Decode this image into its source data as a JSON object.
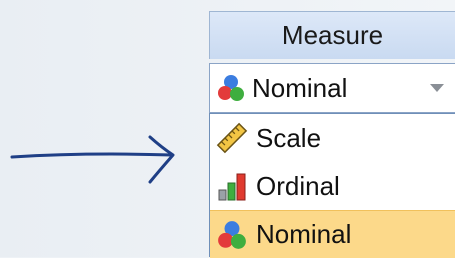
{
  "column": {
    "header": "Measure"
  },
  "combo": {
    "value": "Nominal",
    "icon": "nominal-icon"
  },
  "dropdown": {
    "options": [
      {
        "label": "Scale",
        "icon": "scale-ruler-icon"
      },
      {
        "label": "Ordinal",
        "icon": "ordinal-bars-icon"
      },
      {
        "label": "Nominal",
        "icon": "nominal-icon",
        "selected": true
      }
    ]
  },
  "colors": {
    "header_bg": "#c9daf1",
    "selected_bg": "#fcd98a",
    "arrow": "#1f3f86"
  }
}
